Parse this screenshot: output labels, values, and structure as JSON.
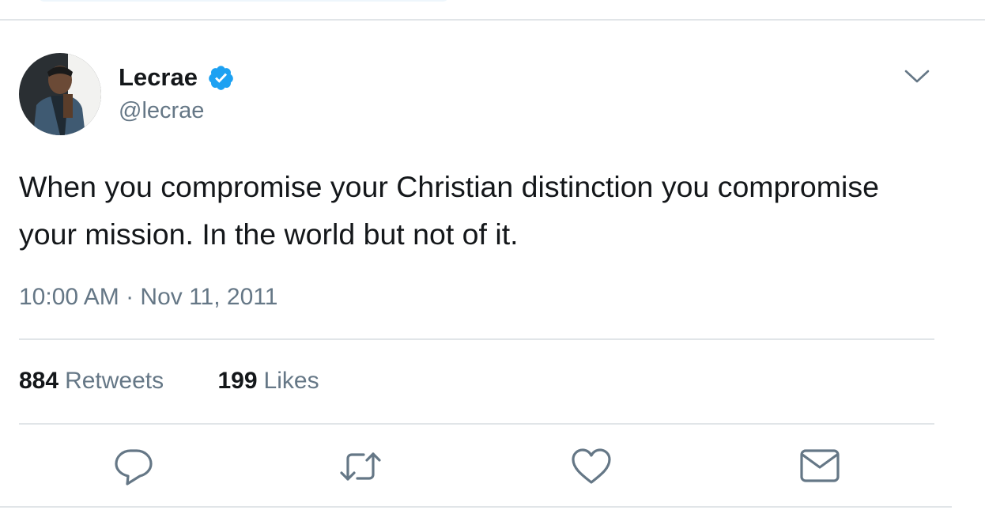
{
  "tweet": {
    "author": {
      "display_name": "Lecrae",
      "handle": "@lecrae",
      "verified": true
    },
    "text": "When you compromise your Christian distinction you compromise your mission. In the world but not of it.",
    "timestamp": "10:00 AM · Nov 11, 2011",
    "stats": {
      "retweets": {
        "count": "884",
        "label": "Retweets"
      },
      "likes": {
        "count": "199",
        "label": "Likes"
      }
    },
    "actions": [
      {
        "name": "reply",
        "icon": "reply-icon"
      },
      {
        "name": "retweet",
        "icon": "retweet-icon"
      },
      {
        "name": "like",
        "icon": "heart-icon"
      },
      {
        "name": "direct-message",
        "icon": "envelope-icon"
      }
    ]
  },
  "colors": {
    "verified_blue": "#1da1f2",
    "icon_gray": "#657786",
    "text_primary": "#14171a",
    "divider": "#e1e5e8"
  }
}
